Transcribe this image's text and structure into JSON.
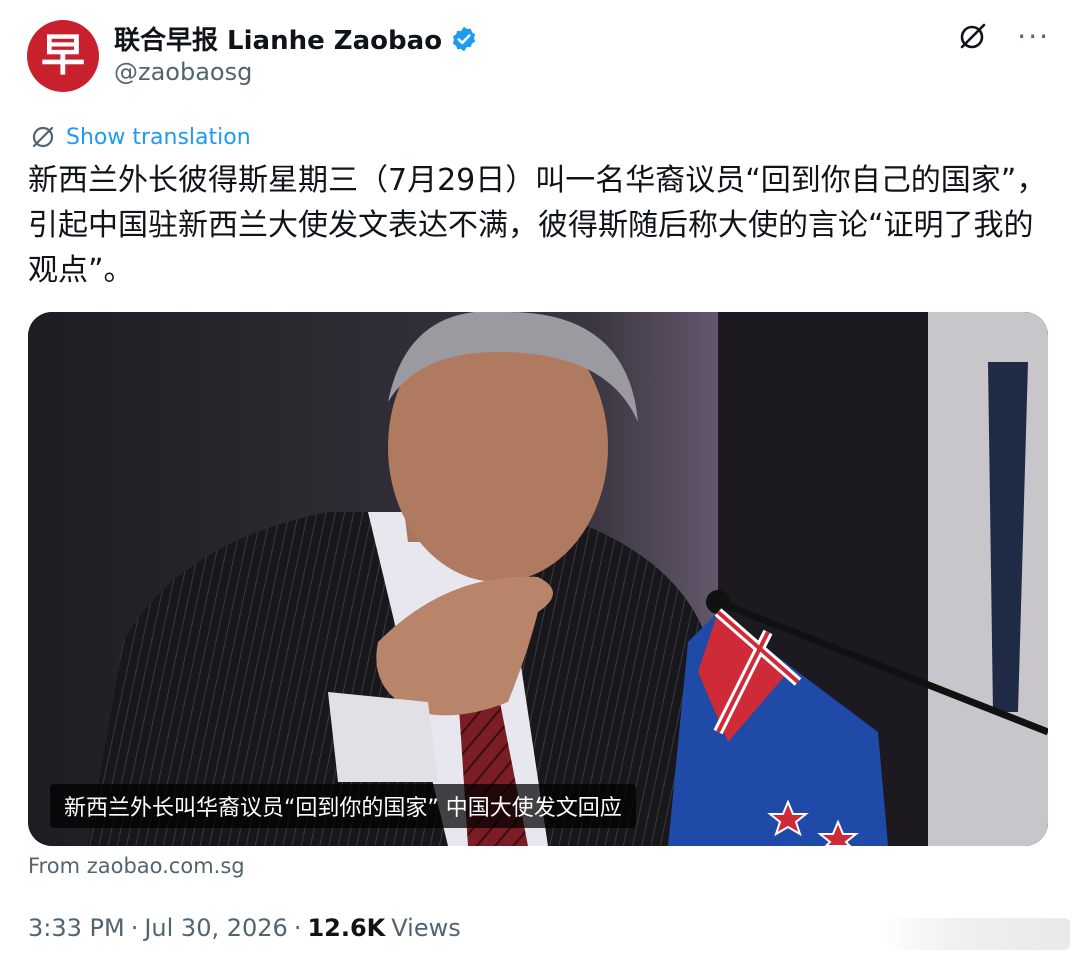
{
  "account": {
    "avatar_glyph": "早",
    "display_name": "联合早报 Lianhe Zaobao",
    "handle": "@zaobaosg",
    "verified": true,
    "avatar_color": "#c8202d",
    "verified_color": "#1d9bf0"
  },
  "actions": {
    "grok_icon": "grok-icon",
    "more_label": "···"
  },
  "translation": {
    "label": "Show translation"
  },
  "post": {
    "text": "新西兰外长彼得斯星期三（7月29日）叫一名华裔议员“回到你自己的国家”，引起中国驻新西兰大使发文表达不满，彼得斯随后称大使的言论“证明了我的观点”。"
  },
  "media": {
    "caption": "新西兰外长叫华裔议员“回到你的国家” 中国大使发文回应"
  },
  "source": {
    "text": "From zaobao.com.sg"
  },
  "meta": {
    "time": "3:33 PM",
    "sep1": "·",
    "date": "Jul 30, 2026",
    "sep2": "·",
    "views_count": "12.6K",
    "views_label": "Views"
  }
}
